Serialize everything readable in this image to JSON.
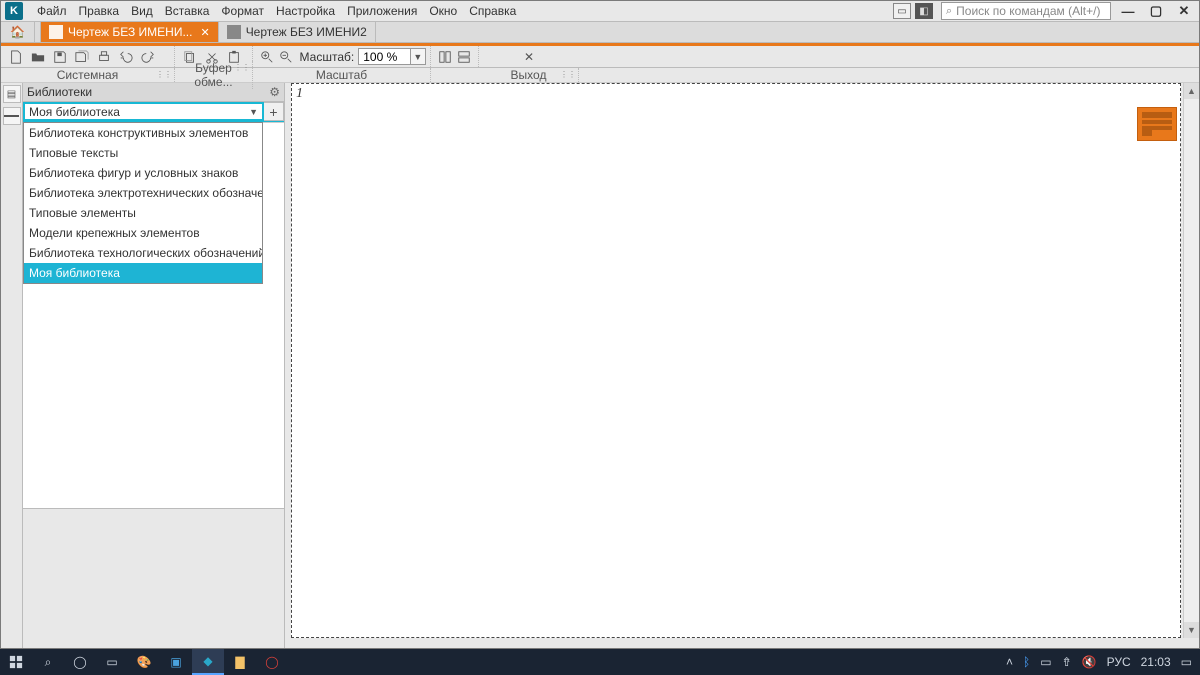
{
  "menubar": {
    "items": [
      "Файл",
      "Правка",
      "Вид",
      "Вставка",
      "Формат",
      "Настройка",
      "Приложения",
      "Окно",
      "Справка"
    ],
    "search_placeholder": "Поиск по командам (Alt+/)"
  },
  "tabs": {
    "home_icon": "home",
    "items": [
      {
        "label": "Чертеж БЕЗ ИМЕНИ...",
        "active": true,
        "closable": true
      },
      {
        "label": "Чертеж БЕЗ ИМЕНИ2",
        "active": false,
        "closable": false
      }
    ]
  },
  "toolbar": {
    "groups": {
      "system_label": "Системная",
      "clip_label": "Буфер обме...",
      "scale_caption": "Масштаб:",
      "scale_value": "100 %",
      "scale_label": "Масштаб",
      "exit_label": "Выход"
    }
  },
  "panel": {
    "title": "Библиотеки",
    "combo_value": "Моя библиотека",
    "dropdown_items": [
      "Библиотека конструктивных элементов",
      "Типовые тексты",
      "Библиотека фигур и условных знаков",
      "Библиотека электротехнических обозначений",
      "Типовые элементы",
      "Модели крепежных элементов",
      "Библиотека технологических обозначений",
      "Моя библиотека"
    ],
    "selected_index": 7
  },
  "canvas": {
    "marker": "1"
  },
  "taskbar": {
    "lang": "РУС",
    "time": "21:03"
  }
}
